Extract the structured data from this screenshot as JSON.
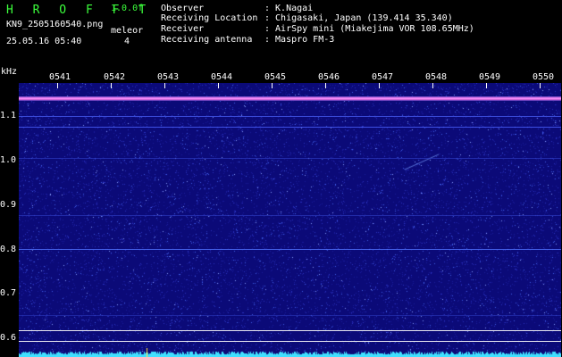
{
  "app": {
    "name": "H R O F F T",
    "version": "1.0.0f"
  },
  "file": {
    "name": "KN9_2505160540.png",
    "datetime": "25.05.16 05:40"
  },
  "meleor": {
    "label": "meleor",
    "count": "4"
  },
  "info": [
    {
      "label": "Observer",
      "value": ": K.Nagai"
    },
    {
      "label": "Receiving Location",
      "value": ": Chigasaki, Japan (139.414 35.340)"
    },
    {
      "label": "Receiver",
      "value": ": AirSpy mini (Miakejima VOR 108.65MHz)"
    },
    {
      "label": "Receiving antenna",
      "value": ": Maspro FM-3"
    }
  ],
  "axis": {
    "unit": "kHz",
    "time_ticks": [
      "0541",
      "0542",
      "0543",
      "0544",
      "0545",
      "0546",
      "0547",
      "0548",
      "0549",
      "0550"
    ],
    "freq_ticks": [
      "1.1",
      "1.0",
      "0.9",
      "0.8",
      "0.7",
      "0.6"
    ]
  },
  "colors": {
    "background": "#0b0a78",
    "text": "#ffffff",
    "title_green": "#3cff3c",
    "carrier_band": "#b050d0",
    "baseline": "#40e0ff"
  }
}
